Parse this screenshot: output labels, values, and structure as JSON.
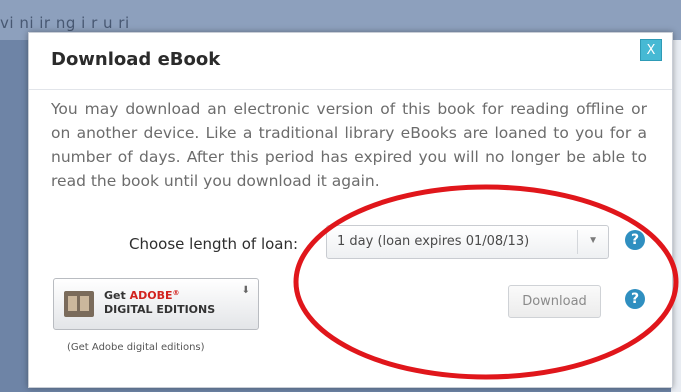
{
  "backdrop": {
    "partial_text": "vi    ni  ir  ng  i  r  u  ri"
  },
  "dialog": {
    "title": "Download eBook",
    "close_label": "X",
    "description": "You may download an electronic version of this book for reading offline or on another device. Like a traditional library eBooks are loaned to you for a number of days. After this period has expired you will no longer be able to read the book until you download it again."
  },
  "loan": {
    "label": "Choose length of loan:",
    "selected_option": "1 day (loan expires 01/08/13)",
    "help_glyph": "?"
  },
  "download": {
    "button_label": "Download",
    "help_glyph": "?"
  },
  "adobe_badge": {
    "line1_prefix": "Get ",
    "line1_brand": "ADOBE",
    "line1_reg": "®",
    "line2": "DIGITAL EDITIONS",
    "caption": "(Get Adobe digital editions)"
  },
  "colors": {
    "close_button": "#46b9d4",
    "help_icon": "#2f8fc0",
    "annotation": "#e0161b",
    "adobe_red": "#d2231f"
  },
  "icons": {
    "close": "close-icon",
    "help": "help-icon",
    "caret": "chevron-down-icon",
    "book": "book-icon",
    "download": "download-arrow-icon"
  }
}
